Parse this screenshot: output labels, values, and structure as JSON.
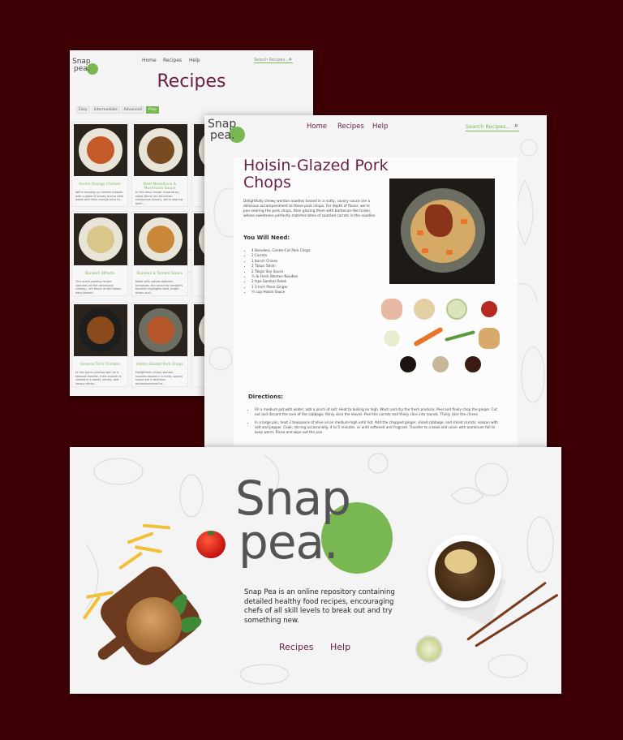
{
  "brand": {
    "name_line1": "Snap",
    "name_line2": "pea.",
    "accent_color": "#79b752",
    "title_color": "#6b1e46",
    "background": "#3e0004"
  },
  "nav": {
    "home": "Home",
    "recipes": "Recipes",
    "help": "Help",
    "search_placeholder": "Search Recipes..."
  },
  "recipes_page": {
    "title": "Recipes",
    "filters": [
      "Easy",
      "Intermediate",
      "Advanced",
      "Prep"
    ],
    "cards": [
      {
        "title": "Ancho Orange Chicken",
        "desc": "We're amping up chicken breasts with a glaze of smoky ancho chile paste and fresh orange juice to..."
      },
      {
        "title": "Beef Medallions & Mushroom Sauce",
        "desc": "In this easy recipe, inspired by steak Diane (an American restaurant classic), we're searing beef..."
      },
      {
        "title": "Bucatini Alfredo",
        "desc": "This quick-cooking recipe captures all the deliciously creamy, rich flavor of the Italian dairy-based..."
      },
      {
        "title": "Bucatini & Tomato Sauce",
        "desc": "Made with yellow datterini tomatoes, the sauce for tonight's bucatini highlights bold, bright olives and..."
      },
      {
        "title": "General Tso's Chicken",
        "desc": "In this quick-cooking spin on a takeout favorite, fried chicken is coated in a sweet, smoky, and savory sticky..."
      },
      {
        "title": "Hoisin-Glazed Pork Chops",
        "desc": "Delightfully chewy wonton noodles tossed in a nutty, savory sauce are a delicious accompaniment to..."
      }
    ]
  },
  "recipe_detail": {
    "title": "Hoisin-Glazed Pork Chops",
    "intro": "Delightfully chewy wonton noodles tossed in a nutty, savory sauce are a delicious accompaniment to these pork chops. For depth of flavor, we're pan-searing the pork chops, then glazing them with barbecue-like hoisin, whose sweetness perfectly matches bites of sautéed carrots in the noodles.",
    "ingredients_heading": "You Will Need:",
    "ingredients": [
      "4 Boneless, Center-Cut Pork Chops",
      "2 Carrots",
      "1 bunch Chives",
      "2 Tbsps Tahini",
      "2 Tbsps Soy Sauce",
      "¾ lb Fresh Wonton Noodles",
      "2 tsps Sambal Oelek",
      "1 1-Inch Piece Ginger",
      "¼ cup Hoisin Sauce"
    ],
    "directions_heading": "Directions:",
    "directions": [
      "Fill a medium pot with water; add a pinch of salt. Heat to boiling on high. Wash and dry the fresh produce. Peel and finely chop the ginger. Cut out and discard the core of the cabbage; thinly slice the leaves. Peel the carrots and thinly slice into rounds. Thinly slice the chives.",
      "In a large pan, heat 2 teaspoons of olive oil on medium-high until hot. Add the chopped ginger, sliced cabbage, and sliced carrots; season with salt and pepper. Cook, stirring occasionally, 4 to 5 minutes, or until softened and fragrant. Transfer to a bowl and cover with aluminum foil to keep warm. Rinse and wipe out the pan."
    ]
  },
  "landing": {
    "description": "Snap Pea is an online repository containing detailed healthy food recipes, encouraging chefs of all skill levels to break out and try something new.",
    "links": [
      "Recipes",
      "Help"
    ]
  }
}
